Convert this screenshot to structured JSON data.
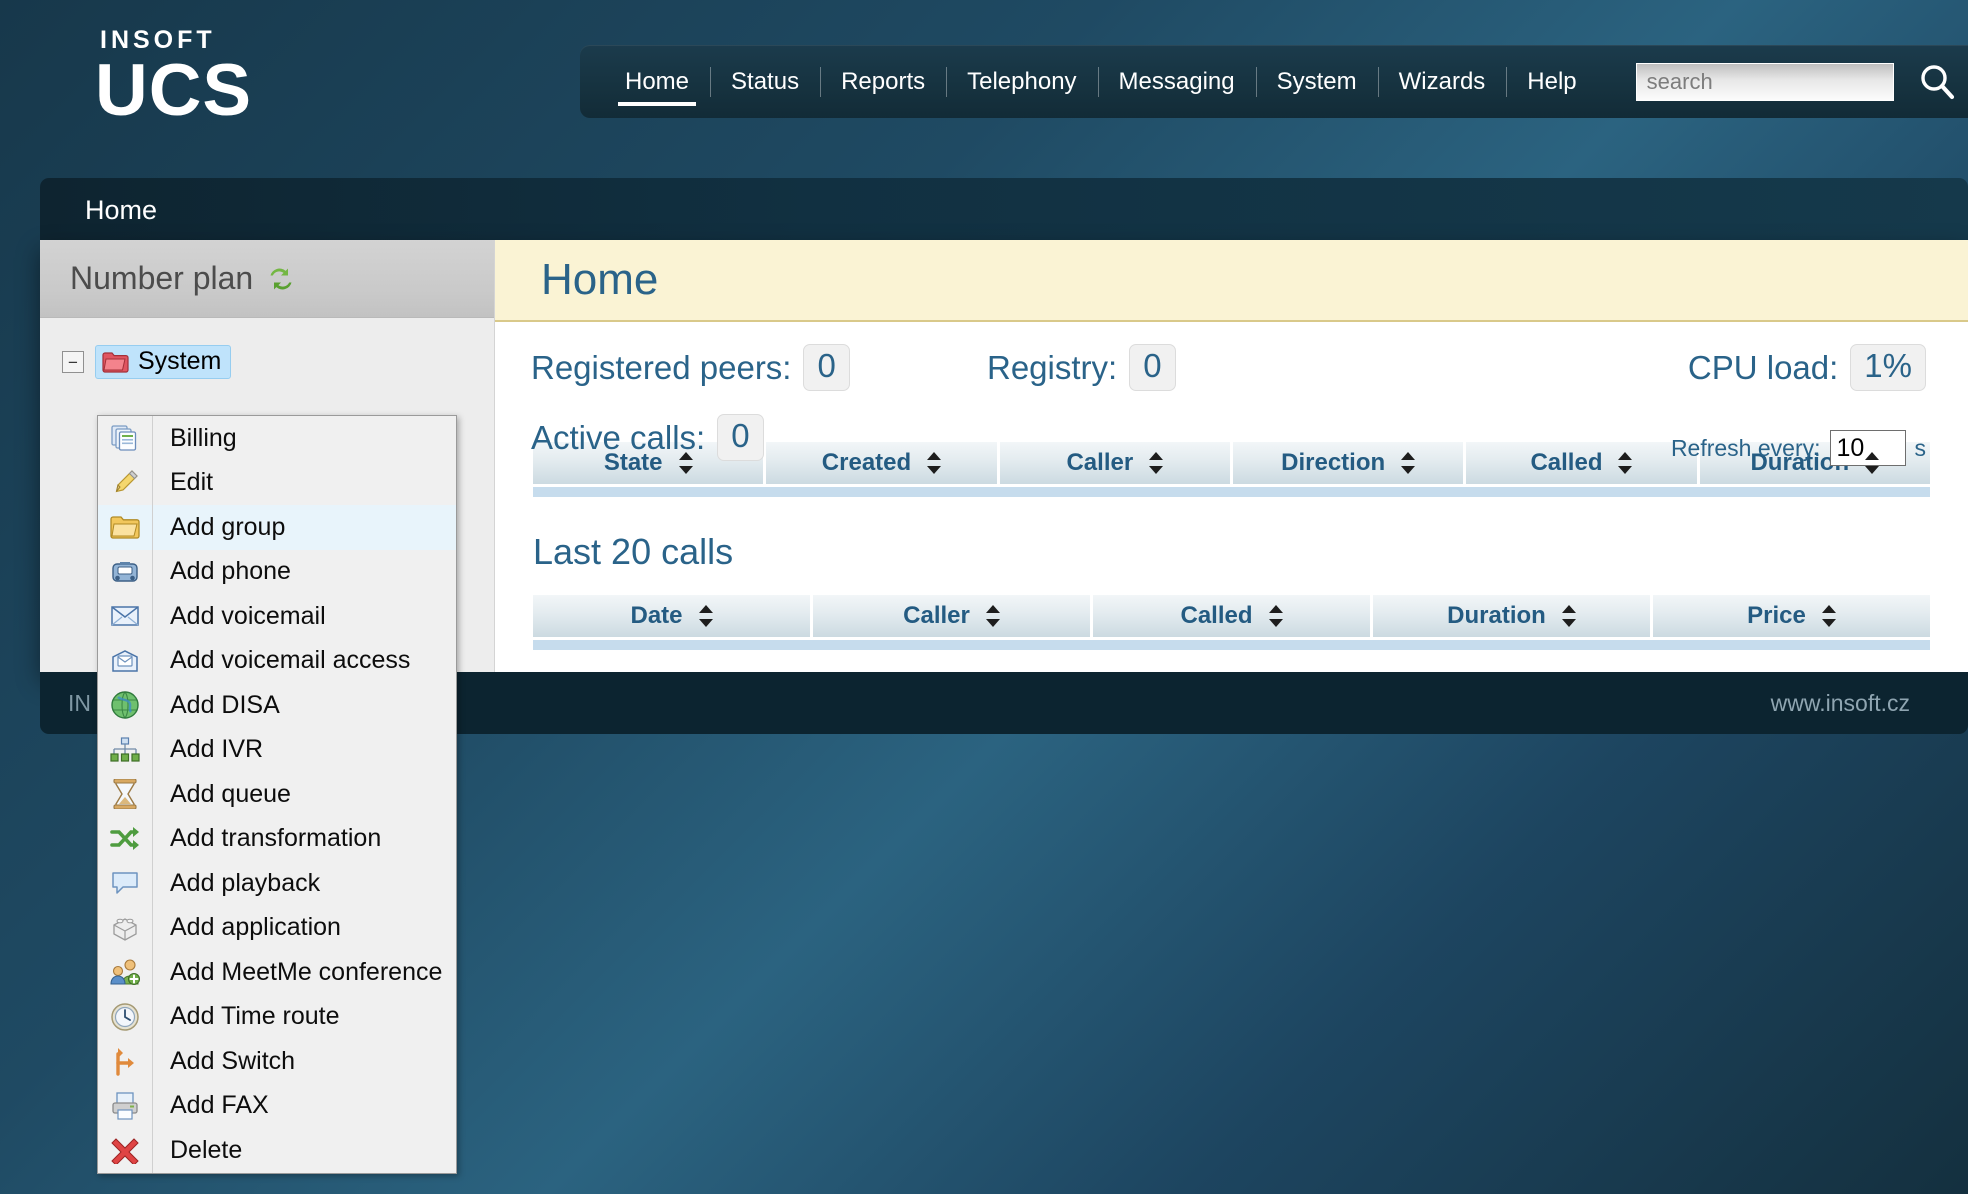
{
  "brand": {
    "top": "INSOFT",
    "main": "UCS"
  },
  "nav": {
    "items": [
      {
        "label": "Home",
        "active": true
      },
      {
        "label": "Status",
        "active": false
      },
      {
        "label": "Reports",
        "active": false
      },
      {
        "label": "Telephony",
        "active": false
      },
      {
        "label": "Messaging",
        "active": false
      },
      {
        "label": "System",
        "active": false
      },
      {
        "label": "Wizards",
        "active": false
      },
      {
        "label": "Help",
        "active": false
      }
    ]
  },
  "search": {
    "value": "",
    "placeholder": "search",
    "icon": "search-icon"
  },
  "breadcrumb": {
    "label": "Home"
  },
  "sidebar": {
    "title": "Number plan",
    "refresh_icon": "refresh-icon",
    "tree": {
      "toggle": "−",
      "node_label": "System",
      "node_icon": "folder-red-icon"
    }
  },
  "context_menu": {
    "items": [
      {
        "label": "Billing",
        "icon": "documents-icon",
        "highlighted": false
      },
      {
        "label": "Edit",
        "icon": "pencil-icon",
        "highlighted": false
      },
      {
        "label": "Add group",
        "icon": "folder-yellow-icon",
        "highlighted": true
      },
      {
        "label": "Add phone",
        "icon": "phone-icon",
        "highlighted": false
      },
      {
        "label": "Add voicemail",
        "icon": "envelope-icon",
        "highlighted": false
      },
      {
        "label": "Add voicemail access",
        "icon": "envelope-open-icon",
        "highlighted": false
      },
      {
        "label": "Add DISA",
        "icon": "globe-icon",
        "highlighted": false
      },
      {
        "label": "Add IVR",
        "icon": "hierarchy-icon",
        "highlighted": false
      },
      {
        "label": "Add queue",
        "icon": "hourglass-icon",
        "highlighted": false
      },
      {
        "label": "Add transformation",
        "icon": "shuffle-icon",
        "highlighted": false
      },
      {
        "label": "Add playback",
        "icon": "speech-bubble-icon",
        "highlighted": false
      },
      {
        "label": "Add application",
        "icon": "brick-icon",
        "highlighted": false
      },
      {
        "label": "Add MeetMe conference",
        "icon": "users-add-icon",
        "highlighted": false
      },
      {
        "label": "Add Time route",
        "icon": "clock-icon",
        "highlighted": false
      },
      {
        "label": "Add Switch",
        "icon": "branch-arrow-icon",
        "highlighted": false
      },
      {
        "label": "Add FAX",
        "icon": "printer-icon",
        "highlighted": false
      },
      {
        "label": "Delete",
        "icon": "red-x-icon",
        "highlighted": false
      }
    ]
  },
  "main": {
    "title": "Home",
    "stats": {
      "registered_peers_label": "Registered peers:",
      "registered_peers_value": "0",
      "registry_label": "Registry:",
      "registry_value": "0",
      "cpu_label": "CPU load:",
      "cpu_value": "1%",
      "active_calls_label": "Active calls:",
      "active_calls_value": "0"
    },
    "refresh": {
      "label": "Refresh every:",
      "value": "10",
      "unit": "s"
    },
    "active_calls_table": {
      "columns": [
        "State",
        "Created",
        "Caller",
        "Direction",
        "Called",
        "Duration"
      ],
      "rows": []
    },
    "last_calls": {
      "title": "Last 20 calls",
      "columns": [
        "Date",
        "Caller",
        "Called",
        "Duration",
        "Price"
      ],
      "rows": []
    }
  },
  "footer": {
    "left": "IN",
    "right": "www.insoft.cz"
  },
  "colors": {
    "accent": "#2a6389",
    "page_head_bg": "#faf3d4",
    "highlight": "#bfe3fb",
    "header_bg": "#15394b"
  }
}
